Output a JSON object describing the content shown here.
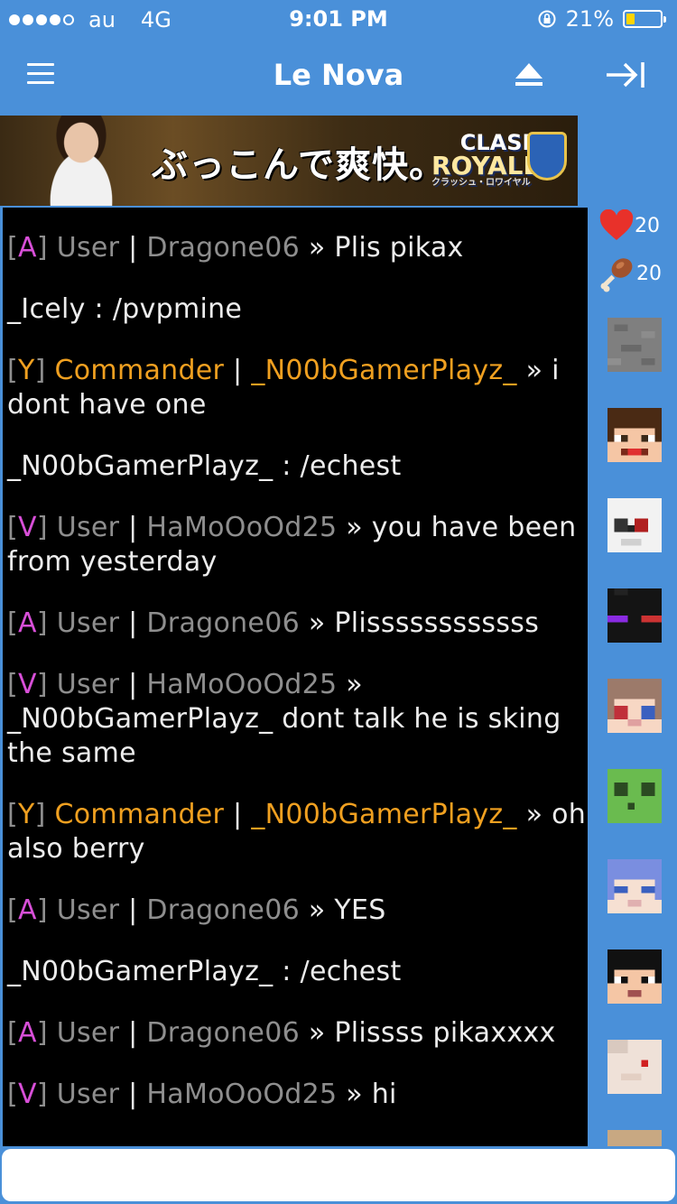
{
  "status_bar": {
    "carrier": "au",
    "network": "4G",
    "time": "9:01 PM",
    "battery_percent": "21%",
    "signal_bars_filled": 4,
    "signal_bars_total": 5
  },
  "nav": {
    "title": "Le Nova"
  },
  "banner": {
    "text": "ぶっこんで爽快。",
    "logo_line1": "CLASH",
    "logo_line2": "ROYALE",
    "logo_line3": "クラッシュ・ロワイヤル"
  },
  "chat": {
    "messages": [
      {
        "tag": "[",
        "rank": "A",
        "tag_close": "]",
        "role": "User",
        "sep": "|",
        "name": "Dragone06",
        "arrow": "»",
        "text": "Plis pikax"
      },
      {
        "plain_name": "_Icely",
        "colon": ":",
        "text": "/pvpmine"
      },
      {
        "tag": "[",
        "rank": "Y",
        "tag_close": "]",
        "role": "Commander",
        "sep": "|",
        "name": "_N00bGamerPlayz_",
        "arrow": "»",
        "text": "i dont have one"
      },
      {
        "plain_name": "_N00bGamerPlayz_",
        "colon": ":",
        "text": "/echest"
      },
      {
        "tag": "[",
        "rank": "V",
        "tag_close": "]",
        "role": "User",
        "sep": "|",
        "name": "HaMoOoOd25",
        "arrow": "»",
        "text": "you have been from yesterday"
      },
      {
        "tag": "[",
        "rank": "A",
        "tag_close": "]",
        "role": "User",
        "sep": "|",
        "name": "Dragone06",
        "arrow": "»",
        "text": "Plissssssssssss"
      },
      {
        "tag": "[",
        "rank": "V",
        "tag_close": "]",
        "role": "User",
        "sep": "|",
        "name": "HaMoOoOd25",
        "arrow": "»",
        "text": "_N00bGamerPlayz_ dont talk he is sking the same"
      },
      {
        "tag": "[",
        "rank": "Y",
        "tag_close": "]",
        "role": "Commander",
        "sep": "|",
        "name": "_N00bGamerPlayz_",
        "arrow": "»",
        "text": "oh also berry"
      },
      {
        "tag": "[",
        "rank": "A",
        "tag_close": "]",
        "role": "User",
        "sep": "|",
        "name": "Dragone06",
        "arrow": "»",
        "text": "YES"
      },
      {
        "plain_name": "_N00bGamerPlayz_",
        "colon": ":",
        "text": "/echest"
      },
      {
        "tag": "[",
        "rank": "A",
        "tag_close": "]",
        "role": "User",
        "sep": "|",
        "name": "Dragone06",
        "arrow": "»",
        "text": "Plissss pikaxxxx"
      },
      {
        "tag": "[",
        "rank": "V",
        "tag_close": "]",
        "role": "User",
        "sep": "|",
        "name": "HaMoOoOd25",
        "arrow": "»",
        "text": "hi"
      }
    ]
  },
  "sidebar": {
    "health": "20",
    "food": "20",
    "player_count": 10
  },
  "input": {
    "value": "",
    "placeholder": ""
  },
  "colors": {
    "theme_blue": "#4a90d9",
    "rank_magenta": "#d84fd8",
    "rank_orange": "#f0a020",
    "muted_gray": "#8e8e8e",
    "chat_bg": "#000000",
    "heart_red": "#e8312a"
  },
  "icons": [
    "menu-icon",
    "eject-icon",
    "exit-icon",
    "heart-icon",
    "drumstick-icon",
    "battery-icon",
    "rotation-lock-icon"
  ]
}
